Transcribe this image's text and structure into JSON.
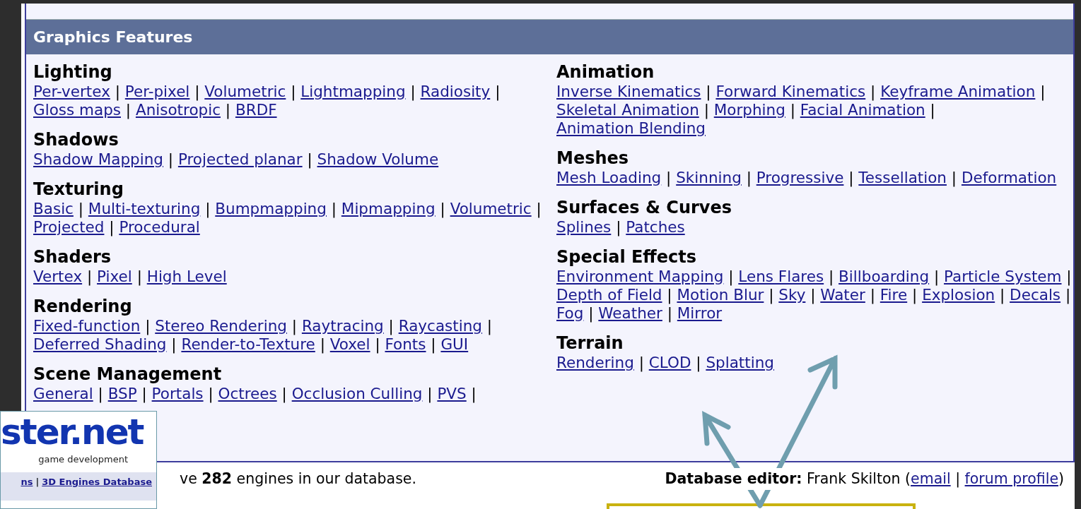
{
  "panel": {
    "title": "Graphics Features",
    "columns": [
      [
        {
          "title": "Lighting",
          "links": [
            {
              "label": "Per-vertex",
              "separator": "|"
            },
            {
              "label": "Per-pixel",
              "separator": "|"
            },
            {
              "label": "Volumetric",
              "separator": "|"
            },
            {
              "label": "Lightmapping",
              "separator": "|"
            },
            {
              "label": "Radiosity",
              "separator": "|"
            },
            {
              "label": "Gloss maps",
              "separator": "|"
            },
            {
              "label": "Anisotropic",
              "separator": "|"
            },
            {
              "label": "BRDF"
            }
          ]
        },
        {
          "title": "Shadows",
          "links": [
            {
              "label": "Shadow Mapping",
              "separator": "|"
            },
            {
              "label": "Projected planar",
              "separator": "|"
            },
            {
              "label": "Shadow Volume"
            }
          ]
        },
        {
          "title": "Texturing",
          "links": [
            {
              "label": "Basic",
              "separator": "|"
            },
            {
              "label": "Multi-texturing",
              "separator": "|"
            },
            {
              "label": "Bumpmapping",
              "separator": "|"
            },
            {
              "label": "Mipmapping",
              "separator": "|"
            },
            {
              "label": "Volumetric",
              "separator": "|"
            },
            {
              "label": "Projected",
              "separator": "|"
            },
            {
              "label": "Procedural"
            }
          ]
        },
        {
          "title": "Shaders",
          "links": [
            {
              "label": "Vertex",
              "separator": "|"
            },
            {
              "label": "Pixel",
              "separator": "|"
            },
            {
              "label": "High Level"
            }
          ]
        },
        {
          "title": "Rendering",
          "links": [
            {
              "label": "Fixed-function",
              "separator": "|"
            },
            {
              "label": "Stereo Rendering",
              "separator": "|"
            },
            {
              "label": "Raytracing",
              "separator": "|"
            },
            {
              "label": "Raycasting",
              "separator": "|"
            },
            {
              "label": "Deferred Shading",
              "separator": "|"
            },
            {
              "label": "Render-to-Texture",
              "separator": "|"
            },
            {
              "label": "Voxel",
              "separator": "|"
            },
            {
              "label": "Fonts",
              "separator": "|"
            },
            {
              "label": "GUI"
            }
          ]
        },
        {
          "title": "Scene Management",
          "links": [
            {
              "label": "General",
              "separator": "|"
            },
            {
              "label": "BSP",
              "separator": "|"
            },
            {
              "label": "Portals",
              "separator": "|"
            },
            {
              "label": "Octrees",
              "separator": "|"
            },
            {
              "label": "Occlusion Culling",
              "separator": "|"
            },
            {
              "label": "PVS",
              "separator": "|"
            }
          ]
        }
      ],
      [
        {
          "title": "Animation",
          "links": [
            {
              "label": "Inverse Kinematics",
              "separator": "|"
            },
            {
              "label": "Forward Kinematics",
              "separator": "|"
            },
            {
              "label": "Keyframe Animation",
              "separator": "|"
            },
            {
              "label": "Skeletal Animation",
              "separator": "|"
            },
            {
              "label": "Morphing",
              "separator": "|"
            },
            {
              "label": "Facial Animation",
              "separator": "|"
            },
            {
              "label": "Animation Blending"
            }
          ]
        },
        {
          "title": "Meshes",
          "links": [
            {
              "label": "Mesh Loading",
              "separator": "|"
            },
            {
              "label": "Skinning",
              "separator": "|"
            },
            {
              "label": "Progressive",
              "separator": "|"
            },
            {
              "label": "Tessellation",
              "separator": "|"
            },
            {
              "label": "Deformation"
            }
          ]
        },
        {
          "title": "Surfaces & Curves",
          "links": [
            {
              "label": "Splines",
              "separator": "|"
            },
            {
              "label": "Patches"
            }
          ]
        },
        {
          "title": "Special Effects",
          "links": [
            {
              "label": "Environment Mapping",
              "separator": "|"
            },
            {
              "label": "Lens Flares",
              "separator": "|"
            },
            {
              "label": "Billboarding",
              "separator": "|"
            },
            {
              "label": "Particle System",
              "separator": "|"
            },
            {
              "label": "Depth of Field",
              "separator": "|"
            },
            {
              "label": "Motion Blur",
              "separator": "|"
            },
            {
              "label": "Sky",
              "separator": "|"
            },
            {
              "label": "Water",
              "separator": "|"
            },
            {
              "label": "Fire",
              "separator": "|"
            },
            {
              "label": "Explosion",
              "separator": "|"
            },
            {
              "label": "Decals",
              "separator": "|"
            },
            {
              "label": "Fog",
              "separator": "|"
            },
            {
              "label": "Weather",
              "separator": "|"
            },
            {
              "label": "Mirror"
            }
          ]
        },
        {
          "title": "Terrain",
          "links": [
            {
              "label": "Rendering",
              "separator": "|"
            },
            {
              "label": "CLOD",
              "separator": "|"
            },
            {
              "label": "Splatting"
            }
          ]
        }
      ]
    ]
  },
  "footer": {
    "count_text": "ve **282** engines in our database.",
    "editor_text": "**Database editor:** Frank Skilton (",
    "editor_links": [
      {
        "label": "email",
        "separator": "|"
      },
      {
        "label": "forum profile"
      }
    ],
    "editor_end": ")"
  },
  "overlay": {
    "logo": "ster.net",
    "tagline": "game development",
    "nav": [
      {
        "label": "ns",
        "separator": "|"
      },
      {
        "label": "3D Engines Database"
      }
    ]
  }
}
